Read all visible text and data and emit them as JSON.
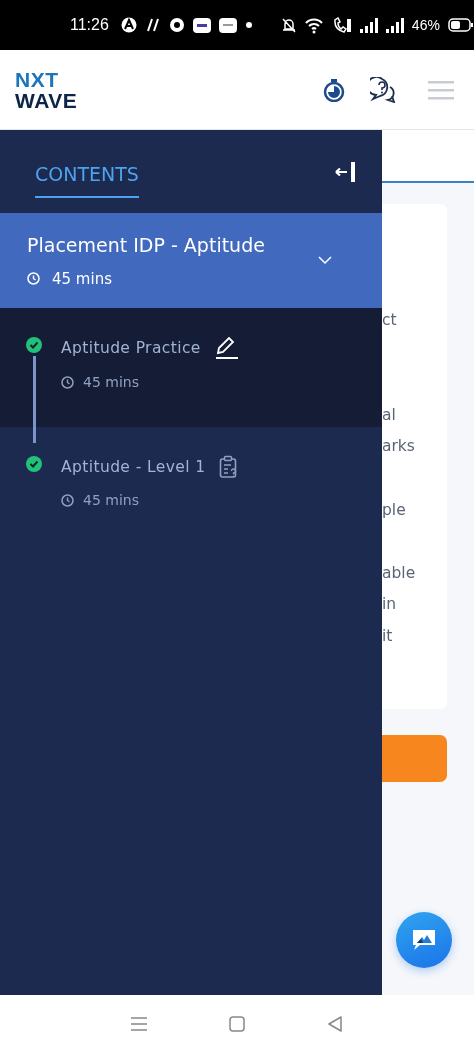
{
  "status_bar": {
    "time": "11:26",
    "battery": "46%"
  },
  "header": {
    "logo": [
      "NXT",
      "WAVE"
    ]
  },
  "drawer": {
    "tabs": [
      {
        "label": "CONTENTS",
        "selected": true
      }
    ],
    "module": {
      "title": "Placement IDP - Aptitude",
      "duration": "45 mins",
      "expanded": true
    },
    "items": [
      {
        "kind": "practice",
        "title": "Aptitude Practice",
        "duration": "45 mins",
        "completed": true,
        "selected": true
      },
      {
        "kind": "quiz",
        "title": "Aptitude - Level 1",
        "duration": "45 mins",
        "completed": true,
        "selected": false
      }
    ]
  },
  "page": {
    "text_fragments": [
      "ct",
      "al",
      "arks",
      "ple",
      "able",
      "in",
      "it"
    ]
  }
}
